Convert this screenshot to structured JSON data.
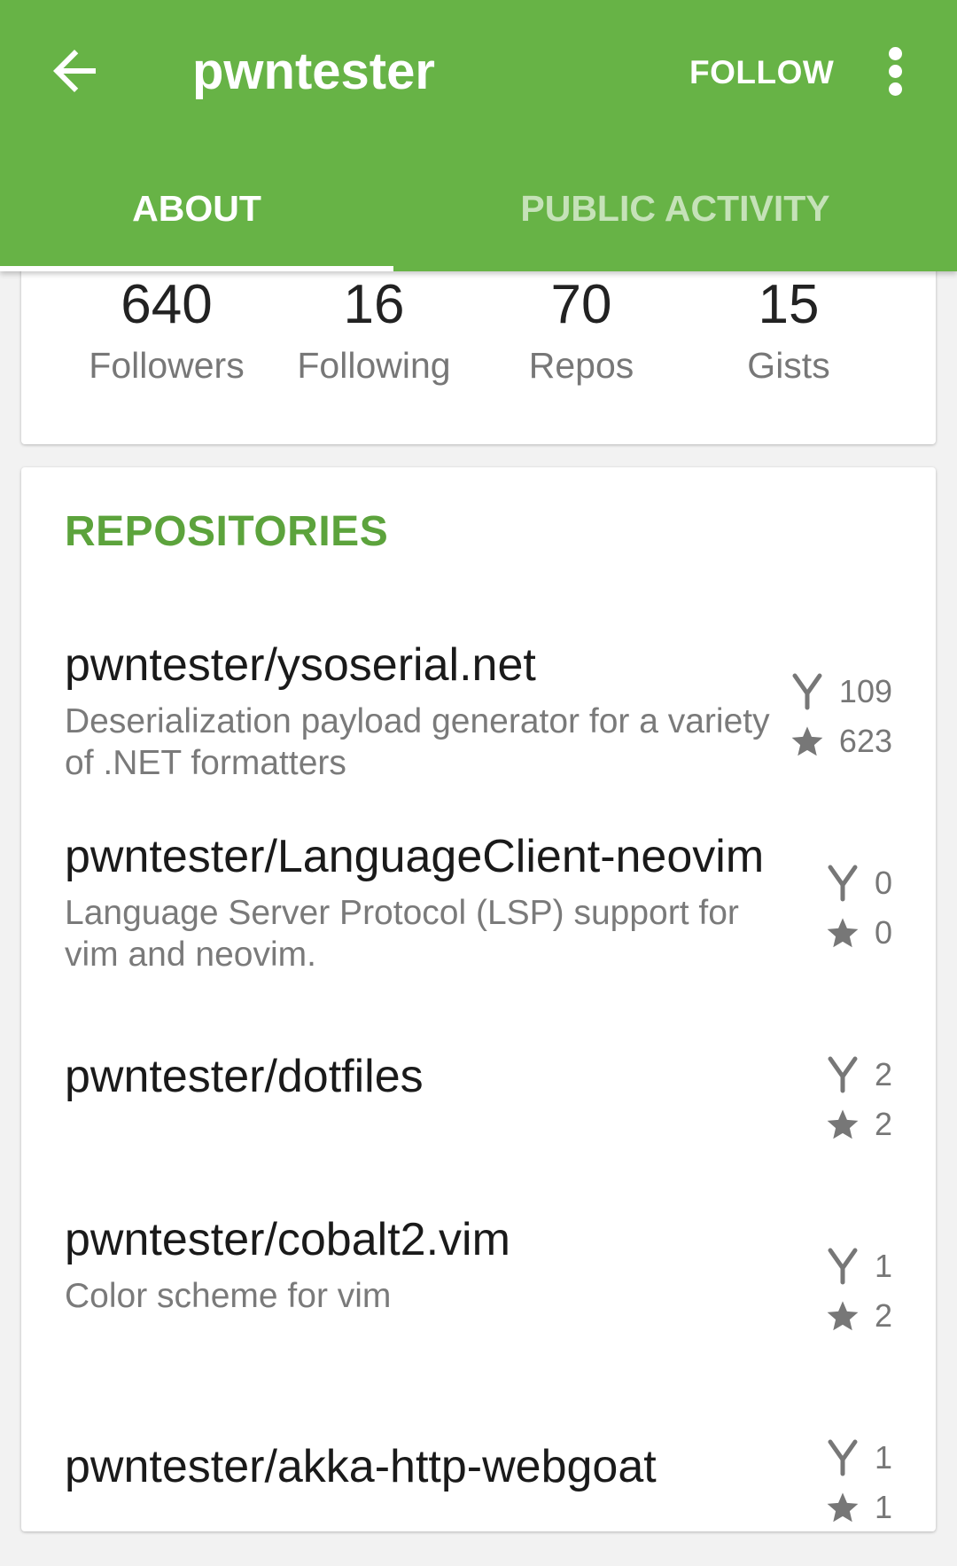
{
  "appbar": {
    "title": "pwntester",
    "follow_label": "FOLLOW",
    "color": "#67b346"
  },
  "tabs": [
    {
      "label": "ABOUT",
      "active": true
    },
    {
      "label": "PUBLIC ACTIVITY",
      "active": false
    }
  ],
  "stats": [
    {
      "value": "640",
      "label": "Followers"
    },
    {
      "value": "16",
      "label": "Following"
    },
    {
      "value": "70",
      "label": "Repos"
    },
    {
      "value": "15",
      "label": "Gists"
    }
  ],
  "repositories": {
    "title": "REPOSITORIES",
    "title_color": "#5ca33c",
    "items": [
      {
        "name": "pwntester/ysoserial.net",
        "description": "Deserialization payload generator for a variety of .NET formatters",
        "forks": "109",
        "stars": "623"
      },
      {
        "name": "pwntester/LanguageClient-neovim",
        "description": "Language Server Protocol (LSP) support for vim and neovim.",
        "forks": "0",
        "stars": "0"
      },
      {
        "name": "pwntester/dotfiles",
        "description": "",
        "forks": "2",
        "stars": "2"
      },
      {
        "name": "pwntester/cobalt2.vim",
        "description": "Color scheme for vim",
        "forks": "1",
        "stars": "2"
      },
      {
        "name": "pwntester/akka-http-webgoat",
        "description": "",
        "forks": "1",
        "stars": "1"
      }
    ]
  },
  "icons": {
    "back": "arrow-back-icon",
    "menu": "more-vert-icon",
    "fork": "fork-icon",
    "star": "star-icon"
  }
}
